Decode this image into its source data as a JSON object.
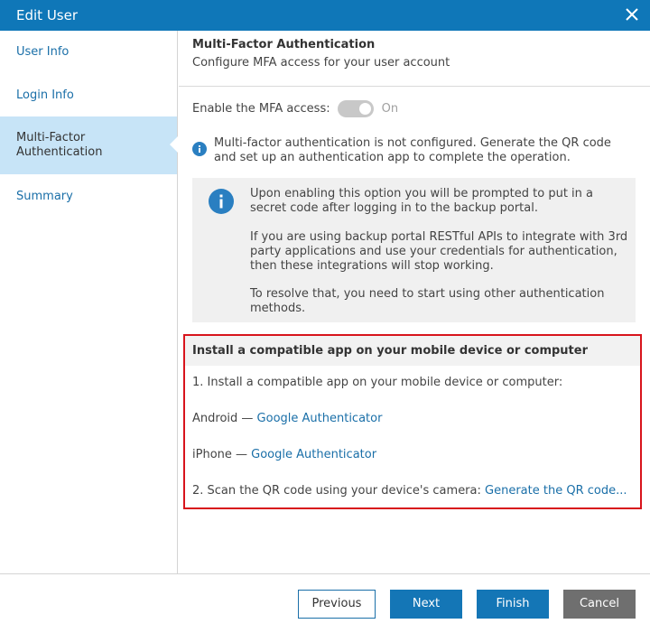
{
  "window": {
    "title": "Edit User"
  },
  "sidebar": {
    "items": [
      {
        "label": "User Info",
        "active": false
      },
      {
        "label": "Login Info",
        "active": false
      },
      {
        "label": "Multi-Factor Authentication",
        "label_line1": "Multi-Factor",
        "label_line2": "Authentication",
        "active": true
      },
      {
        "label": "Summary",
        "active": false
      }
    ]
  },
  "header": {
    "title": "Multi-Factor Authentication",
    "subtitle": "Configure MFA access for your user account"
  },
  "mfa": {
    "label": "Enable the MFA access:",
    "toggle_state": "On"
  },
  "notice": {
    "icon": "info-icon",
    "text": "Multi-factor authentication is not configured. Generate the QR code and set up an authentication app to complete the operation."
  },
  "info_box": {
    "icon": "info-circle-icon",
    "paragraphs": [
      "Upon enabling this option you will be prompted to put in a secret code after logging in to the backup portal.",
      "If you are using backup portal RESTful APIs to integrate with 3rd party applications and use your credentials for authentication, then these integrations will stop working.",
      "To resolve that, you need to start using other authentication methods."
    ]
  },
  "install": {
    "heading": "Install a compatible app on your mobile device or computer",
    "step1": "1. Install a compatible app on your mobile device or computer:",
    "android_label": "Android —",
    "android_link": "Google Authenticator",
    "iphone_label": "iPhone —",
    "iphone_link": "Google Authenticator",
    "step2": "2. Scan the QR code using your device's camera:",
    "qr_link": "Generate the QR code..."
  },
  "footer": {
    "previous": "Previous",
    "next": "Next",
    "finish": "Finish",
    "cancel": "Cancel"
  },
  "colors": {
    "titlebar": "#0f77b8",
    "accent": "#1476b6",
    "link": "#1a6fa8",
    "active_nav": "#c7e4f7",
    "highlight_border": "#d8141c",
    "cancel": "#6f6f6f"
  }
}
